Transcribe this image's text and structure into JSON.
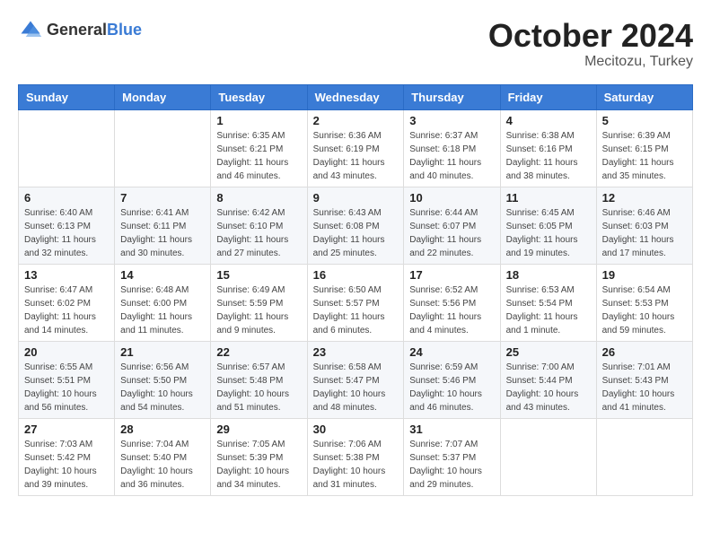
{
  "header": {
    "logo_general": "General",
    "logo_blue": "Blue",
    "month_title": "October 2024",
    "subtitle": "Mecitozu, Turkey"
  },
  "weekdays": [
    "Sunday",
    "Monday",
    "Tuesday",
    "Wednesday",
    "Thursday",
    "Friday",
    "Saturday"
  ],
  "weeks": [
    [
      {
        "day": "",
        "info": ""
      },
      {
        "day": "",
        "info": ""
      },
      {
        "day": "1",
        "info": "Sunrise: 6:35 AM\nSunset: 6:21 PM\nDaylight: 11 hours and 46 minutes."
      },
      {
        "day": "2",
        "info": "Sunrise: 6:36 AM\nSunset: 6:19 PM\nDaylight: 11 hours and 43 minutes."
      },
      {
        "day": "3",
        "info": "Sunrise: 6:37 AM\nSunset: 6:18 PM\nDaylight: 11 hours and 40 minutes."
      },
      {
        "day": "4",
        "info": "Sunrise: 6:38 AM\nSunset: 6:16 PM\nDaylight: 11 hours and 38 minutes."
      },
      {
        "day": "5",
        "info": "Sunrise: 6:39 AM\nSunset: 6:15 PM\nDaylight: 11 hours and 35 minutes."
      }
    ],
    [
      {
        "day": "6",
        "info": "Sunrise: 6:40 AM\nSunset: 6:13 PM\nDaylight: 11 hours and 32 minutes."
      },
      {
        "day": "7",
        "info": "Sunrise: 6:41 AM\nSunset: 6:11 PM\nDaylight: 11 hours and 30 minutes."
      },
      {
        "day": "8",
        "info": "Sunrise: 6:42 AM\nSunset: 6:10 PM\nDaylight: 11 hours and 27 minutes."
      },
      {
        "day": "9",
        "info": "Sunrise: 6:43 AM\nSunset: 6:08 PM\nDaylight: 11 hours and 25 minutes."
      },
      {
        "day": "10",
        "info": "Sunrise: 6:44 AM\nSunset: 6:07 PM\nDaylight: 11 hours and 22 minutes."
      },
      {
        "day": "11",
        "info": "Sunrise: 6:45 AM\nSunset: 6:05 PM\nDaylight: 11 hours and 19 minutes."
      },
      {
        "day": "12",
        "info": "Sunrise: 6:46 AM\nSunset: 6:03 PM\nDaylight: 11 hours and 17 minutes."
      }
    ],
    [
      {
        "day": "13",
        "info": "Sunrise: 6:47 AM\nSunset: 6:02 PM\nDaylight: 11 hours and 14 minutes."
      },
      {
        "day": "14",
        "info": "Sunrise: 6:48 AM\nSunset: 6:00 PM\nDaylight: 11 hours and 11 minutes."
      },
      {
        "day": "15",
        "info": "Sunrise: 6:49 AM\nSunset: 5:59 PM\nDaylight: 11 hours and 9 minutes."
      },
      {
        "day": "16",
        "info": "Sunrise: 6:50 AM\nSunset: 5:57 PM\nDaylight: 11 hours and 6 minutes."
      },
      {
        "day": "17",
        "info": "Sunrise: 6:52 AM\nSunset: 5:56 PM\nDaylight: 11 hours and 4 minutes."
      },
      {
        "day": "18",
        "info": "Sunrise: 6:53 AM\nSunset: 5:54 PM\nDaylight: 11 hours and 1 minute."
      },
      {
        "day": "19",
        "info": "Sunrise: 6:54 AM\nSunset: 5:53 PM\nDaylight: 10 hours and 59 minutes."
      }
    ],
    [
      {
        "day": "20",
        "info": "Sunrise: 6:55 AM\nSunset: 5:51 PM\nDaylight: 10 hours and 56 minutes."
      },
      {
        "day": "21",
        "info": "Sunrise: 6:56 AM\nSunset: 5:50 PM\nDaylight: 10 hours and 54 minutes."
      },
      {
        "day": "22",
        "info": "Sunrise: 6:57 AM\nSunset: 5:48 PM\nDaylight: 10 hours and 51 minutes."
      },
      {
        "day": "23",
        "info": "Sunrise: 6:58 AM\nSunset: 5:47 PM\nDaylight: 10 hours and 48 minutes."
      },
      {
        "day": "24",
        "info": "Sunrise: 6:59 AM\nSunset: 5:46 PM\nDaylight: 10 hours and 46 minutes."
      },
      {
        "day": "25",
        "info": "Sunrise: 7:00 AM\nSunset: 5:44 PM\nDaylight: 10 hours and 43 minutes."
      },
      {
        "day": "26",
        "info": "Sunrise: 7:01 AM\nSunset: 5:43 PM\nDaylight: 10 hours and 41 minutes."
      }
    ],
    [
      {
        "day": "27",
        "info": "Sunrise: 7:03 AM\nSunset: 5:42 PM\nDaylight: 10 hours and 39 minutes."
      },
      {
        "day": "28",
        "info": "Sunrise: 7:04 AM\nSunset: 5:40 PM\nDaylight: 10 hours and 36 minutes."
      },
      {
        "day": "29",
        "info": "Sunrise: 7:05 AM\nSunset: 5:39 PM\nDaylight: 10 hours and 34 minutes."
      },
      {
        "day": "30",
        "info": "Sunrise: 7:06 AM\nSunset: 5:38 PM\nDaylight: 10 hours and 31 minutes."
      },
      {
        "day": "31",
        "info": "Sunrise: 7:07 AM\nSunset: 5:37 PM\nDaylight: 10 hours and 29 minutes."
      },
      {
        "day": "",
        "info": ""
      },
      {
        "day": "",
        "info": ""
      }
    ]
  ]
}
